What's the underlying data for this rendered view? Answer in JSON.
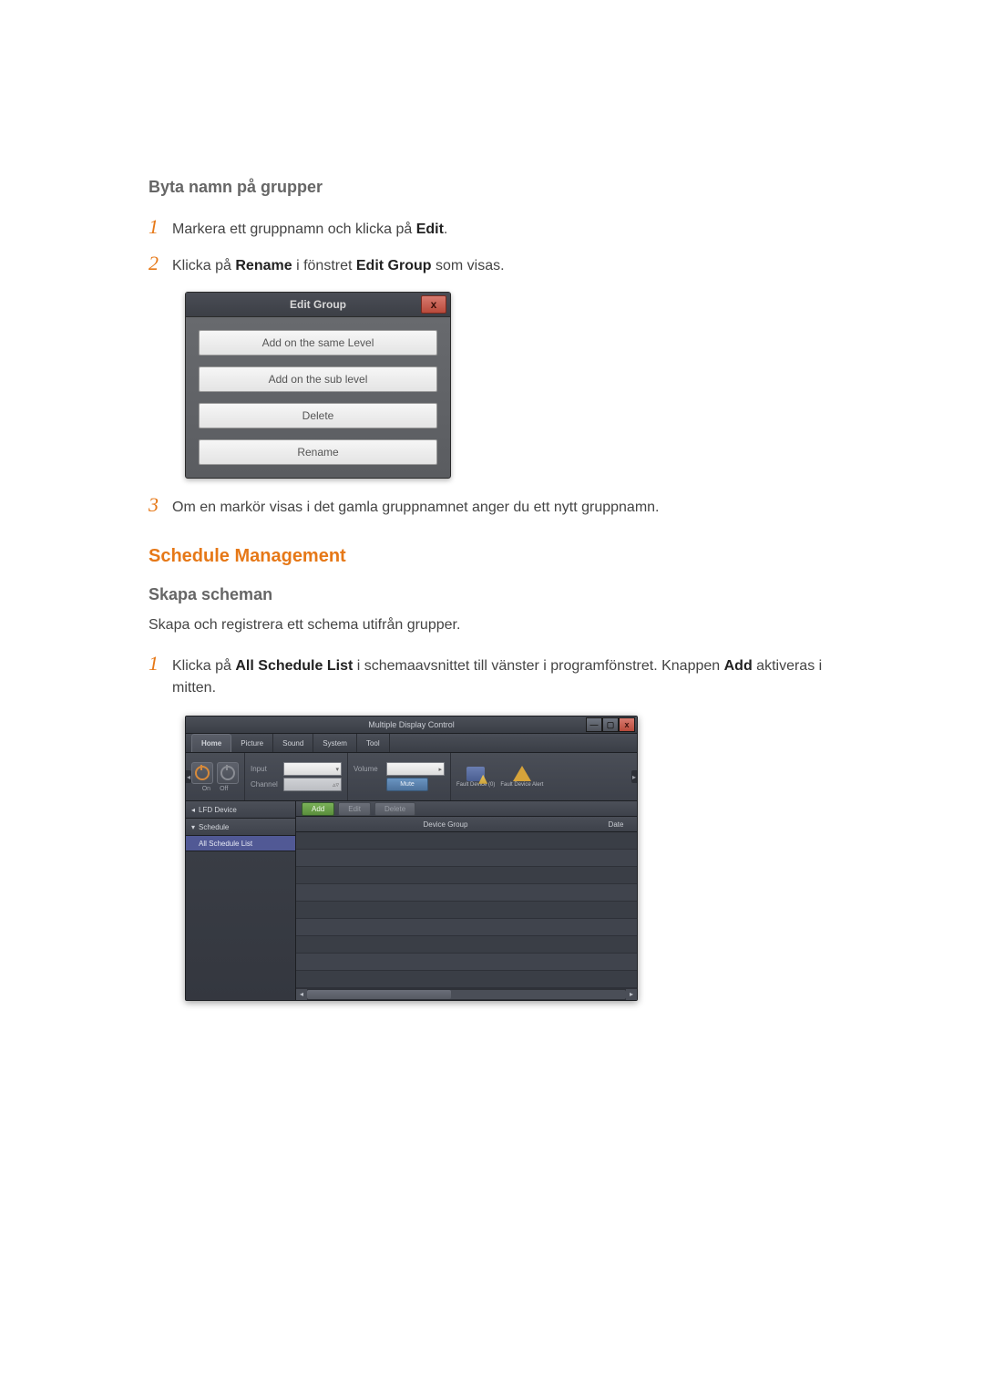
{
  "headings": {
    "rename_groups": "Byta namn på grupper",
    "schedule_management": "Schedule Management",
    "create_schedules": "Skapa scheman"
  },
  "steps_rename": {
    "s1": {
      "pre": "Markera ett gruppnamn och klicka på ",
      "bold1": "Edit",
      "post": "."
    },
    "s2": {
      "pre": "Klicka på ",
      "bold1": "Rename",
      "mid": " i fönstret ",
      "bold2": "Edit Group",
      "post": " som visas."
    },
    "s3": "Om en markör visas i det gamla gruppnamnet anger du ett nytt gruppnamn."
  },
  "dialog": {
    "title": "Edit Group",
    "close": "x",
    "buttons": {
      "same_level": "Add on the same Level",
      "sub_level": "Add on the sub level",
      "delete": "Delete",
      "rename": "Rename"
    }
  },
  "paragraph_create": "Skapa och registrera ett schema utifrån grupper.",
  "steps_create": {
    "s1": {
      "pre": "Klicka på ",
      "bold1": "All Schedule List",
      "mid": " i schemaavsnittet till vänster i programfönstret. Knappen ",
      "bold2": "Add",
      "post": " aktiveras i mitten."
    }
  },
  "app": {
    "title": "Multiple Display Control",
    "win_controls": {
      "min": "—",
      "max": "▢",
      "close": "x"
    },
    "help": "?",
    "tabs": {
      "home": "Home",
      "picture": "Picture",
      "sound": "Sound",
      "system": "System",
      "tool": "Tool"
    },
    "ribbon": {
      "on": "On",
      "off": "Off",
      "input_label": "Input",
      "channel_label": "Channel",
      "volume_label": "Volume",
      "mute_btn": "Mute",
      "fault_device": "Fault Device\n(0)",
      "fault_alert": "Fault Device\nAlert"
    },
    "sidebar": {
      "lfd": "LFD Device",
      "schedule": "Schedule",
      "all_schedule_list": "All Schedule List"
    },
    "actions": {
      "add": "Add",
      "edit": "Edit",
      "delete": "Delete"
    },
    "columns": {
      "device_group": "Device Group",
      "date": "Date"
    }
  },
  "numbers": {
    "one": "1",
    "two": "2",
    "three": "3"
  }
}
